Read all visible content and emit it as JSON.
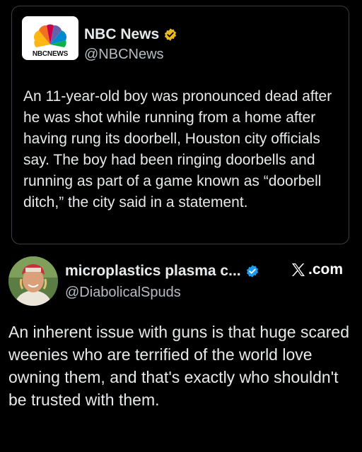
{
  "quoted_post": {
    "author_name": "NBC News",
    "author_handle": "@NBCNews",
    "avatar_text": "NBCNEWS",
    "verified_badge": "gold-verified-badge",
    "text": "An 11-year-old boy was pronounced dead after he was shot while running from a home after having rung its doorbell, Houston city officials say. The boy had been ringing doorbells and running as part of a game known as “doorbell ditch,” the city said in a statement."
  },
  "main_post": {
    "author_name": "microplastics plasma c...",
    "author_handle": "@DiabolicalSpuds",
    "verified_badge": "blue-verified-badge",
    "source_label": ".com",
    "source_logo": "x-logo",
    "text": "An inherent issue with guns is that huge scared weenies who are terrified of the world love owning them, and that's exactly who shouldn't be trusted with them."
  },
  "colors": {
    "background": "#000000",
    "text": "#e7e9ea",
    "secondary_text": "#b7bcc1",
    "card_border": "#3a3e42",
    "gold_badge": "#e8b923",
    "blue_badge": "#1d9bf0"
  }
}
